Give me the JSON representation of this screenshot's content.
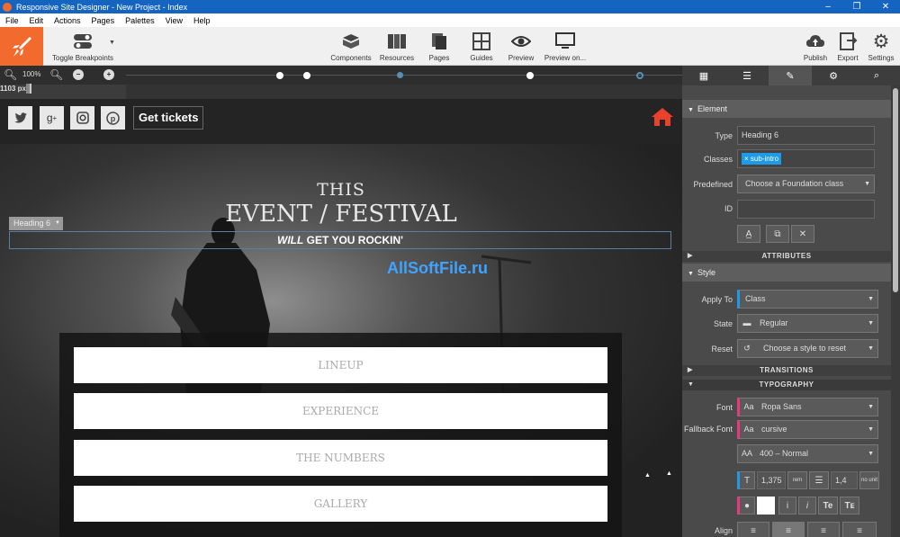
{
  "window": {
    "title": "Responsive Site Designer - New Project - Index"
  },
  "menu": [
    "File",
    "Edit",
    "Actions",
    "Pages",
    "Palettes",
    "View",
    "Help"
  ],
  "toolbar": {
    "toggle_breakpoints": "Toggle Breakpoints",
    "components": "Components",
    "resources": "Resources",
    "pages": "Pages",
    "guides": "Guides",
    "preview": "Preview",
    "preview_on": "Preview on...",
    "publish": "Publish",
    "export": "Export",
    "settings": "Settings"
  },
  "zoom": {
    "level": "100%",
    "width": "1103 px"
  },
  "canvas": {
    "get_tickets": "Get tickets",
    "heading_this": "THIS",
    "heading_event": "EVENT / FESTIVAL",
    "sub_will": "WILL",
    "sub_rest": " GET YOU ROCKIN'",
    "selected_label": "Heading 6",
    "watermark": "AllSoftFile.ru",
    "menu_items": [
      "LINEUP",
      "EXPERIENCE",
      "THE NUMBERS",
      "GALLERY"
    ]
  },
  "panel": {
    "element_header": "Element",
    "type_label": "Type",
    "type_value": "Heading 6",
    "classes_label": "Classes",
    "class_tag": "sub-intro",
    "predefined_label": "Predefined",
    "predefined_value": "Choose a Foundation class",
    "id_label": "ID",
    "id_value": "",
    "attributes_header": "ATTRIBUTES",
    "style_header": "Style",
    "apply_to_label": "Apply To",
    "apply_to_value": "Class",
    "state_label": "State",
    "state_value": "Regular",
    "reset_label": "Reset",
    "reset_value": "Choose a style to reset",
    "transitions_header": "TRANSITIONS",
    "typography_header": "TYPOGRAPHY",
    "font_label": "Font",
    "font_value": "Ropa Sans",
    "fallback_label": "Fallback Font",
    "fallback_value": "cursive",
    "weight_value": "400 – Normal",
    "size_value": "1,375",
    "size_unit": "rem",
    "line_value": "1,4",
    "line_unit": "no unit",
    "align_label": "Align"
  },
  "colors": {
    "accent": "#f26a2e",
    "titlebar": "#1565c0",
    "tag": "#1e9be8"
  }
}
